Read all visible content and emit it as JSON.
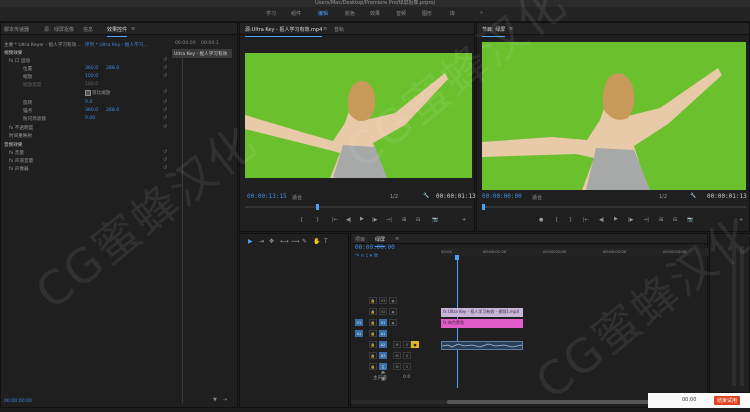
{
  "window": {
    "title": "Users/Mac/Desktop/Premiere Pro/绿屏抠像.prproj"
  },
  "workspaces": [
    {
      "label": "学习",
      "active": false
    },
    {
      "label": "组件",
      "active": false
    },
    {
      "label": "编辑",
      "active": true
    },
    {
      "label": "颜色",
      "active": false
    },
    {
      "label": "效果",
      "active": false
    },
    {
      "label": "音频",
      "active": false
    },
    {
      "label": "图形",
      "active": false
    },
    {
      "label": "库",
      "active": false
    }
  ],
  "workspaces_more": "»",
  "left_panel": {
    "tabs": [
      "脚本传递器",
      "源：绿屏抠像",
      "信息",
      "效果控件"
    ],
    "active_tab": "效果控件",
    "tab_menu": "≡",
    "source_label": "主要 * Ultra Keyer - 抠人学习有效...",
    "target_label": "序列 * Ultra Key - 抠人学习...",
    "timeline_time": "00:00:00",
    "timeline_end": "00:00:1",
    "clip_label": "Ultra Key - 抠人学习有效",
    "sections": [
      "视频效果"
    ],
    "rows": [
      {
        "indent": 1,
        "name": "fx 口 运动",
        "value": "",
        "reset": "↺"
      },
      {
        "indent": 2,
        "name": "位置",
        "value": "360.0",
        "value2": "288.0",
        "reset": "↺"
      },
      {
        "indent": 2,
        "name": "缩放",
        "value": "100.0",
        "reset": "↺"
      },
      {
        "indent": 2,
        "name": "缩放宽度",
        "value": "100.0",
        "reset": ""
      },
      {
        "indent": 3,
        "name": "等比缩放",
        "value": "",
        "reset": "↺",
        "checkbox": true
      },
      {
        "indent": 2,
        "name": "旋转",
        "value": "0.0",
        "reset": "↺"
      },
      {
        "indent": 2,
        "name": "锚点",
        "value": "360.0",
        "value2": "288.0",
        "reset": "↺"
      },
      {
        "indent": 2,
        "name": "防闪烁滤镜",
        "value": "0.00",
        "reset": "↺"
      },
      {
        "indent": 1,
        "name": "fx 不透明度",
        "value": "",
        "reset": "↺"
      },
      {
        "indent": 1,
        "name": "时间重映射",
        "value": "",
        "reset": ""
      }
    ],
    "audio_section": "音频效果",
    "audio_rows": [
      {
        "name": "fx 音量",
        "reset": "↺"
      },
      {
        "name": "fx 声道音量",
        "reset": "↺"
      },
      {
        "name": "fx 声像器",
        "reset": "↺"
      }
    ],
    "footer_time": "00:00:00:00"
  },
  "source_monitor": {
    "tab_label": "源:Ultra Key - 抠人学习有效.mp4",
    "tab_menu": "≡",
    "tab2": "音轨",
    "timecode": "00:00:13:15",
    "fit": "适合",
    "quality": "1/2",
    "duration": "00:00:01:13",
    "controls": [
      "{",
      "}",
      "|←",
      "◀|",
      "▶",
      "|▶",
      "→|",
      "⊞",
      "⊟",
      "📷",
      "+"
    ]
  },
  "program_monitor": {
    "tab_label": "节目: 绿屏",
    "tab_menu": "≡",
    "timecode": "00:00:00:00",
    "fit": "适合",
    "quality": "1/2",
    "duration": "00:00:01:13",
    "controls": [
      "●",
      "{",
      "}",
      "|←",
      "◀|",
      "▶",
      "|▶",
      "→|",
      "⊞",
      "⊟",
      "📷",
      "+"
    ]
  },
  "timeline": {
    "tabs": [
      "项目",
      "绿屏"
    ],
    "active_tab": "绿屏",
    "tab_menu": "≡",
    "timecode": "00:00:00:00",
    "ruler": [
      "00:00",
      "00:00:01:00",
      "00:00:02:00",
      "00:00:03:00",
      "00:00:04:00"
    ],
    "tracks": [
      {
        "name": "V3",
        "label": "V3"
      },
      {
        "name": "V2",
        "label": "V2"
      },
      {
        "name": "V1",
        "label": "V1"
      },
      {
        "name": "A1",
        "label": "A1"
      },
      {
        "name": "A2",
        "label": "A2"
      },
      {
        "name": "A3",
        "label": "A3"
      },
      {
        "name": "主声道",
        "label": "主声道",
        "value": "0.0"
      }
    ],
    "clip_v2": "fx  Ultra Key - 抠人学习有效 - 视频1.mp4",
    "clip_v1": "fx  纯色蒙版",
    "tools": [
      "▶",
      "⇥",
      "✥",
      "⟷",
      "⟿",
      "✎",
      "✋",
      "T"
    ]
  },
  "status_bar": {
    "time": "00:00",
    "button": "结束试用"
  },
  "watermark": "CG蜜蜂汉化",
  "colors": {
    "accent": "#4ba1ff",
    "greenscreen": "#6ac02d",
    "clip_v2": "#c8b6d9",
    "clip_v1": "#e35dc9"
  }
}
